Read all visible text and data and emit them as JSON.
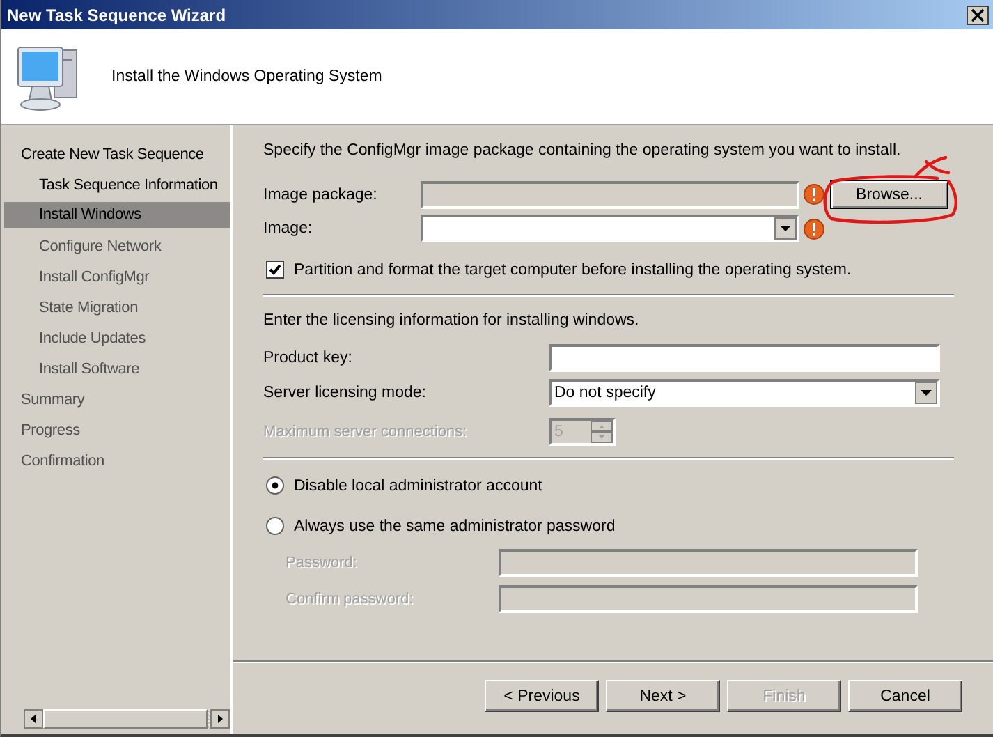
{
  "window": {
    "title": "New Task Sequence Wizard"
  },
  "header": {
    "title": "Install the Windows Operating System"
  },
  "sidebar": {
    "items": [
      {
        "label": "Create New Task Sequence",
        "selected": false,
        "disabled": false,
        "children": [
          {
            "label": "Task Sequence Information",
            "selected": false,
            "disabled": false
          },
          {
            "label": "Install Windows",
            "selected": true,
            "disabled": false
          },
          {
            "label": "Configure Network",
            "selected": false,
            "disabled": true
          },
          {
            "label": "Install ConfigMgr",
            "selected": false,
            "disabled": true
          },
          {
            "label": "State Migration",
            "selected": false,
            "disabled": true
          },
          {
            "label": "Include Updates",
            "selected": false,
            "disabled": true
          },
          {
            "label": "Install Software",
            "selected": false,
            "disabled": true
          }
        ]
      },
      {
        "label": "Summary",
        "selected": false,
        "disabled": true
      },
      {
        "label": "Progress",
        "selected": false,
        "disabled": true
      },
      {
        "label": "Confirmation",
        "selected": false,
        "disabled": true
      }
    ]
  },
  "page": {
    "intro": "Specify the ConfigMgr image package containing the operating system you want to install.",
    "image_package": {
      "label": "Image package:",
      "disabled": true,
      "error": true
    },
    "browse_button": "Browse...",
    "image": {
      "label": "Image:",
      "disabled": false,
      "error": true
    },
    "partition": {
      "label": "Partition and format the target computer before installing the operating system.",
      "checked": true
    },
    "licensing_intro": "Enter the licensing information for installing windows.",
    "product_key": {
      "label": "Product key:",
      "disabled": false
    },
    "server_licensing_mode": {
      "label": "Server licensing mode:",
      "value": "Do not specify",
      "disabled": false
    },
    "max_connections": {
      "label": "Maximum server connections:",
      "value": "5",
      "disabled": true
    },
    "admin_options": [
      {
        "label": "Disable local administrator account",
        "selected": true
      },
      {
        "label": "Always use the same administrator password",
        "selected": false
      }
    ],
    "password": {
      "label": "Password:",
      "disabled": true
    },
    "confirm_password": {
      "label": "Confirm password:",
      "disabled": true
    }
  },
  "buttons": [
    {
      "label": "< Previous",
      "disabled": false
    },
    {
      "label": "Next >",
      "disabled": false
    },
    {
      "label": "Finish",
      "disabled": true
    },
    {
      "label": "Cancel",
      "disabled": false
    }
  ]
}
